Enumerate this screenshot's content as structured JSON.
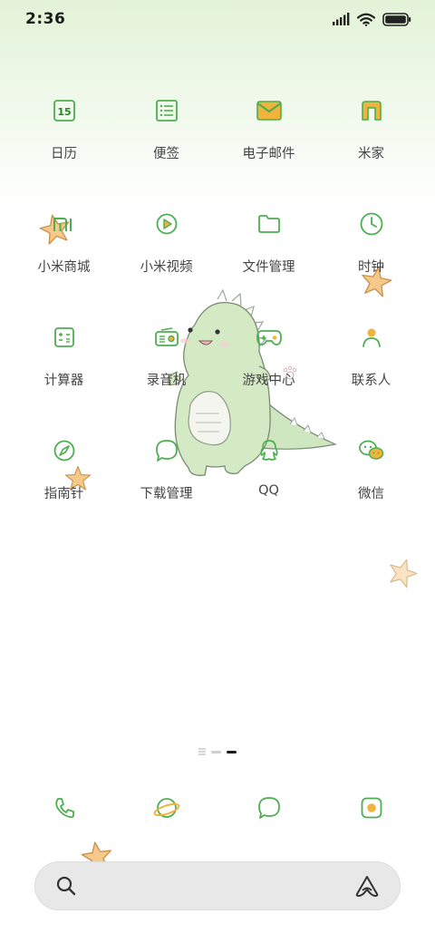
{
  "status_bar": {
    "time": "2:36",
    "battery_level": 1.0
  },
  "apps": [
    {
      "label": "日历",
      "icon": "calendar-icon",
      "badge_text": "15"
    },
    {
      "label": "便签",
      "icon": "notes-icon"
    },
    {
      "label": "电子邮件",
      "icon": "email-icon"
    },
    {
      "label": "米家",
      "icon": "mijia-icon"
    },
    {
      "label": "小米商城",
      "icon": "mi-store-icon",
      "badge_text": "mi"
    },
    {
      "label": "小米视频",
      "icon": "video-icon"
    },
    {
      "label": "文件管理",
      "icon": "folder-icon"
    },
    {
      "label": "时钟",
      "icon": "clock-icon"
    },
    {
      "label": "计算器",
      "icon": "calculator-icon"
    },
    {
      "label": "录音机",
      "icon": "recorder-icon"
    },
    {
      "label": "游戏中心",
      "icon": "gamepad-icon"
    },
    {
      "label": "联系人",
      "icon": "contacts-icon"
    },
    {
      "label": "指南针",
      "icon": "compass-icon"
    },
    {
      "label": "下载管理",
      "icon": "download-icon"
    },
    {
      "label": "QQ",
      "icon": "qq-icon"
    },
    {
      "label": "微信",
      "icon": "wechat-icon"
    }
  ],
  "page_indicator": {
    "pages": 2,
    "current": 2
  },
  "dock": [
    {
      "icon": "phone-icon"
    },
    {
      "icon": "browser-icon"
    },
    {
      "icon": "messages-icon"
    },
    {
      "icon": "camera-icon"
    }
  ],
  "colors": {
    "accent_green": "#4caf50",
    "accent_orange": "#f2b33d",
    "star_fill": "#f6c98a"
  }
}
